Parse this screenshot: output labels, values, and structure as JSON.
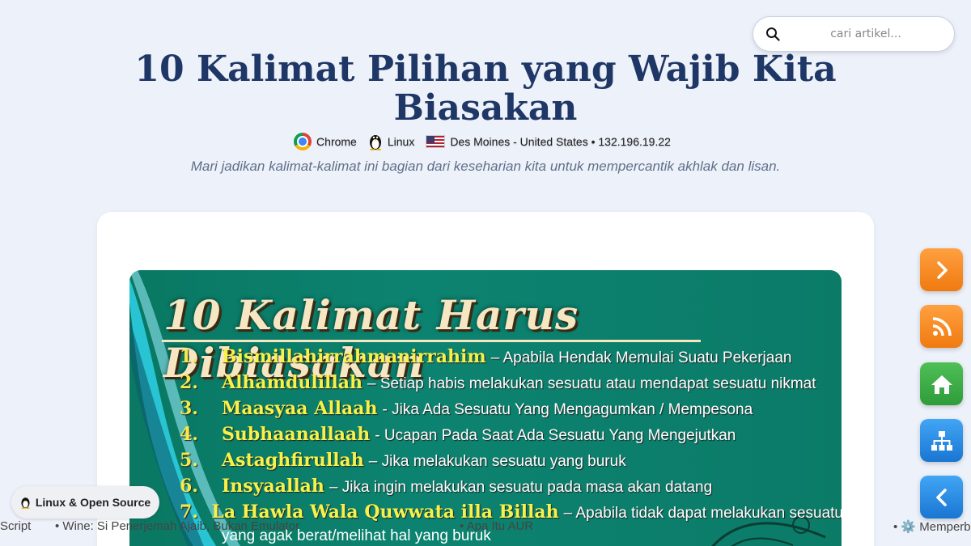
{
  "search": {
    "placeholder": "cari artikel..."
  },
  "article": {
    "title": "10 Kalimat Pilihan yang Wajib Kita Biasakan",
    "meta": {
      "browser": "Chrome",
      "os": "Linux",
      "location": "Des Moines - United States • 132.196.19.22"
    },
    "subtitle": "Mari jadikan kalimat-kalimat ini bagian dari keseharian kita untuk mempercantik akhlak dan lisan."
  },
  "poster": {
    "title": "10 Kalimat Harus Dibiasakan",
    "items": [
      {
        "num": "1.",
        "term": "Bismillahirrahmanirrahim",
        "desc": "– Apabila Hendak Memulai Suatu Pekerjaan"
      },
      {
        "num": "2.",
        "term": "Alhamdulillah",
        "desc": "– Setiap habis melakukan sesuatu atau mendapat sesuatu nikmat"
      },
      {
        "num": "3.",
        "term": "Maasyaa Allaah",
        "desc": "- Jika Ada Sesuatu Yang Mengagumkan / Mempesona"
      },
      {
        "num": "4.",
        "term": "Subhaanallaah",
        "desc": "- Ucapan Pada Saat Ada Sesuatu Yang Mengejutkan"
      },
      {
        "num": "5.",
        "term": "Astaghfirullah",
        "desc": "– Jika melakukan sesuatu yang buruk"
      },
      {
        "num": "6.",
        "term": "Insyaallah",
        "desc": "– Jika ingin melakukan sesuatu pada masa akan datang"
      },
      {
        "num": "7.",
        "term": "La Hawla Wala Quwwata illa Billah",
        "desc": "– Apabila tidak dapat melakukan sesuatu"
      }
    ],
    "item7_continuation": "yang agak berat/melihat hal yang buruk"
  },
  "side_buttons": {
    "next": "chevron-right-icon",
    "rss": "rss-icon",
    "home": "home-icon",
    "sitemap": "sitemap-icon",
    "prev": "chevron-left-icon"
  },
  "category_pill": {
    "label": "Linux & Open Source"
  },
  "ticker": {
    "items": [
      "Script",
      "• Wine: Si Penerjemah Ajaib, Bukan Emulator",
      "• Apa Itu AUR",
      "• ⚙️ Memperb"
    ]
  },
  "colors": {
    "background": "#edf1f9",
    "title": "#1f3766",
    "poster_bg": "#0b7b68",
    "poster_term": "#f7f24a"
  }
}
